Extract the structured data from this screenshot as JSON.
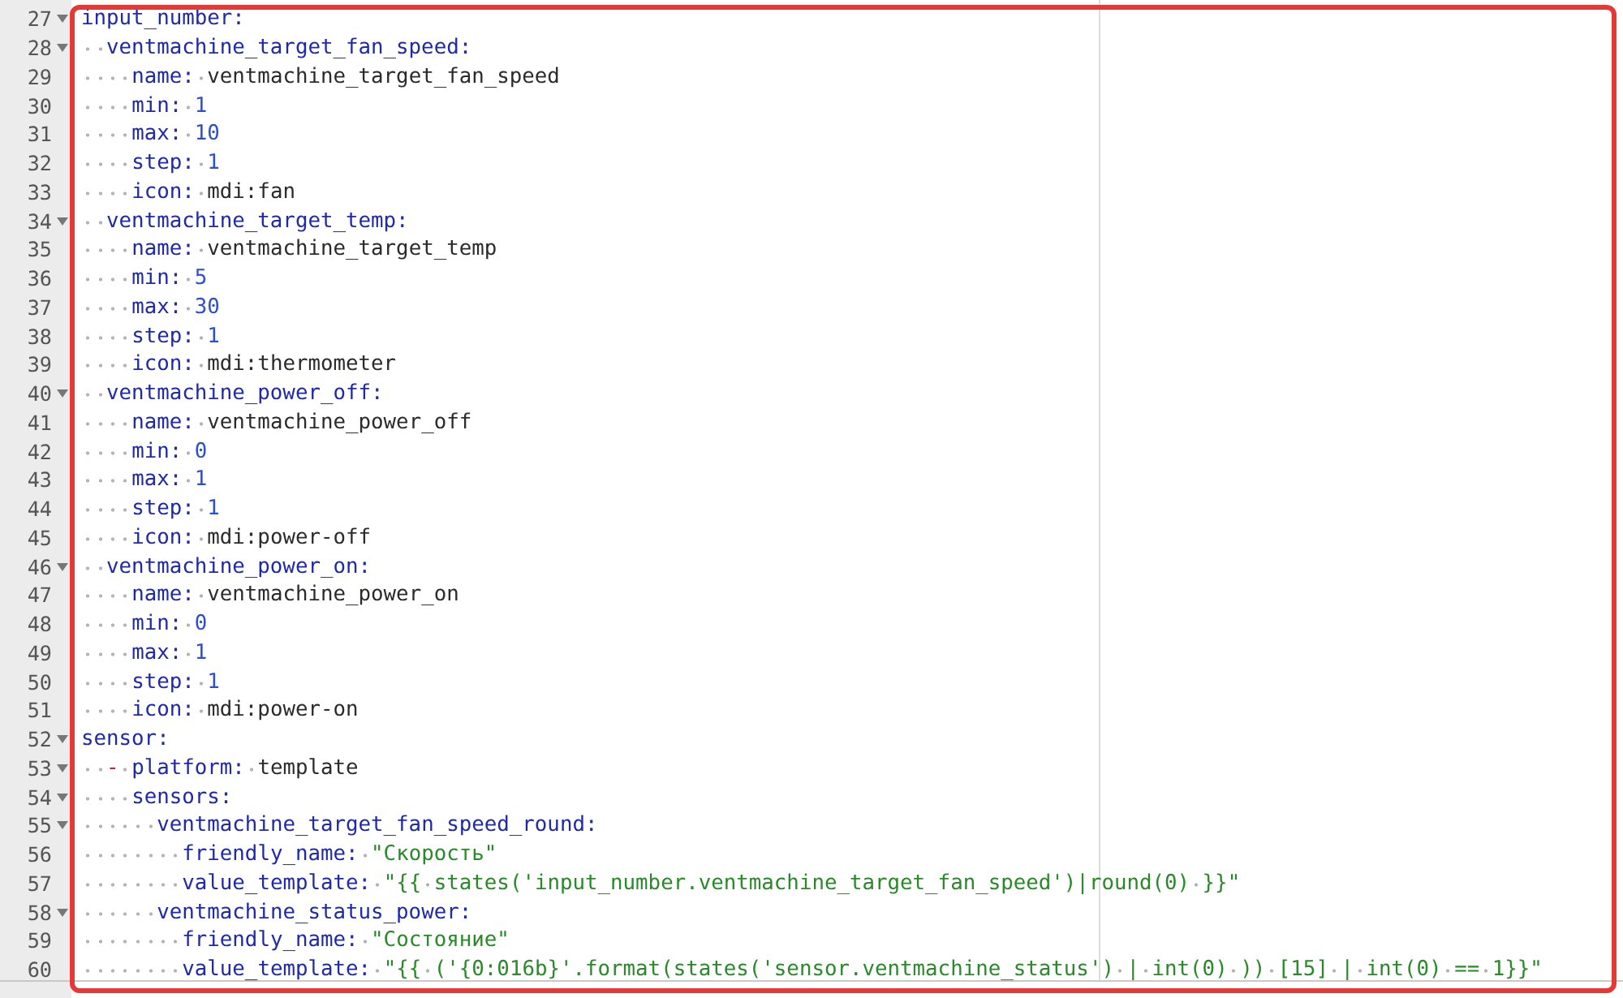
{
  "editor": {
    "lines": [
      {
        "number": "27",
        "fold": true,
        "tokens": [
          {
            "kind": "key",
            "text": "input_number:"
          }
        ]
      },
      {
        "number": "28",
        "fold": true,
        "tokens": [
          {
            "kind": "key",
            "text": "  ventmachine_target_fan_speed:"
          }
        ]
      },
      {
        "number": "29",
        "fold": false,
        "tokens": [
          {
            "kind": "key",
            "text": "    name:"
          },
          {
            "kind": "plain",
            "text": " ventmachine_target_fan_speed"
          }
        ]
      },
      {
        "number": "30",
        "fold": false,
        "tokens": [
          {
            "kind": "key",
            "text": "    min:"
          },
          {
            "kind": "num",
            "text": " 1"
          }
        ]
      },
      {
        "number": "31",
        "fold": false,
        "tokens": [
          {
            "kind": "key",
            "text": "    max:"
          },
          {
            "kind": "num",
            "text": " 10"
          }
        ]
      },
      {
        "number": "32",
        "fold": false,
        "tokens": [
          {
            "kind": "key",
            "text": "    step:"
          },
          {
            "kind": "num",
            "text": " 1"
          }
        ]
      },
      {
        "number": "33",
        "fold": false,
        "tokens": [
          {
            "kind": "key",
            "text": "    icon:"
          },
          {
            "kind": "plain",
            "text": " mdi:fan"
          }
        ]
      },
      {
        "number": "34",
        "fold": true,
        "tokens": [
          {
            "kind": "key",
            "text": "  ventmachine_target_temp:"
          }
        ]
      },
      {
        "number": "35",
        "fold": false,
        "tokens": [
          {
            "kind": "key",
            "text": "    name:"
          },
          {
            "kind": "plain",
            "text": " ventmachine_target_temp"
          }
        ]
      },
      {
        "number": "36",
        "fold": false,
        "tokens": [
          {
            "kind": "key",
            "text": "    min:"
          },
          {
            "kind": "num",
            "text": " 5"
          }
        ]
      },
      {
        "number": "37",
        "fold": false,
        "tokens": [
          {
            "kind": "key",
            "text": "    max:"
          },
          {
            "kind": "num",
            "text": " 30"
          }
        ]
      },
      {
        "number": "38",
        "fold": false,
        "tokens": [
          {
            "kind": "key",
            "text": "    step:"
          },
          {
            "kind": "num",
            "text": " 1"
          }
        ]
      },
      {
        "number": "39",
        "fold": false,
        "tokens": [
          {
            "kind": "key",
            "text": "    icon:"
          },
          {
            "kind": "plain",
            "text": " mdi:thermometer"
          }
        ]
      },
      {
        "number": "40",
        "fold": true,
        "tokens": [
          {
            "kind": "key",
            "text": "  ventmachine_power_off:"
          }
        ]
      },
      {
        "number": "41",
        "fold": false,
        "tokens": [
          {
            "kind": "key",
            "text": "    name:"
          },
          {
            "kind": "plain",
            "text": " ventmachine_power_off"
          }
        ]
      },
      {
        "number": "42",
        "fold": false,
        "tokens": [
          {
            "kind": "key",
            "text": "    min:"
          },
          {
            "kind": "num",
            "text": " 0"
          }
        ]
      },
      {
        "number": "43",
        "fold": false,
        "tokens": [
          {
            "kind": "key",
            "text": "    max:"
          },
          {
            "kind": "num",
            "text": " 1"
          }
        ]
      },
      {
        "number": "44",
        "fold": false,
        "tokens": [
          {
            "kind": "key",
            "text": "    step:"
          },
          {
            "kind": "num",
            "text": " 1"
          }
        ]
      },
      {
        "number": "45",
        "fold": false,
        "tokens": [
          {
            "kind": "key",
            "text": "    icon:"
          },
          {
            "kind": "plain",
            "text": " mdi:power-off"
          }
        ]
      },
      {
        "number": "46",
        "fold": true,
        "tokens": [
          {
            "kind": "key",
            "text": "  ventmachine_power_on:"
          }
        ]
      },
      {
        "number": "47",
        "fold": false,
        "tokens": [
          {
            "kind": "key",
            "text": "    name:"
          },
          {
            "kind": "plain",
            "text": " ventmachine_power_on"
          }
        ]
      },
      {
        "number": "48",
        "fold": false,
        "tokens": [
          {
            "kind": "key",
            "text": "    min:"
          },
          {
            "kind": "num",
            "text": " 0"
          }
        ]
      },
      {
        "number": "49",
        "fold": false,
        "tokens": [
          {
            "kind": "key",
            "text": "    max:"
          },
          {
            "kind": "num",
            "text": " 1"
          }
        ]
      },
      {
        "number": "50",
        "fold": false,
        "tokens": [
          {
            "kind": "key",
            "text": "    step:"
          },
          {
            "kind": "num",
            "text": " 1"
          }
        ]
      },
      {
        "number": "51",
        "fold": false,
        "tokens": [
          {
            "kind": "key",
            "text": "    icon:"
          },
          {
            "kind": "plain",
            "text": " mdi:power-on"
          }
        ]
      },
      {
        "number": "52",
        "fold": true,
        "tokens": [
          {
            "kind": "key",
            "text": "sensor:"
          }
        ]
      },
      {
        "number": "53",
        "fold": true,
        "tokens": [
          {
            "kind": "dash",
            "text": "  -"
          },
          {
            "kind": "key",
            "text": " platform:"
          },
          {
            "kind": "plain",
            "text": " template"
          }
        ]
      },
      {
        "number": "54",
        "fold": true,
        "tokens": [
          {
            "kind": "key",
            "text": "    sensors:"
          }
        ]
      },
      {
        "number": "55",
        "fold": true,
        "tokens": [
          {
            "kind": "key",
            "text": "      ventmachine_target_fan_speed_round:"
          }
        ]
      },
      {
        "number": "56",
        "fold": false,
        "tokens": [
          {
            "kind": "key",
            "text": "        friendly_name:"
          },
          {
            "kind": "str",
            "text": " \"Скорость\""
          }
        ]
      },
      {
        "number": "57",
        "fold": false,
        "tokens": [
          {
            "kind": "key",
            "text": "        value_template:"
          },
          {
            "kind": "str",
            "text": " \"{{ states('input_number.ventmachine_target_fan_speed')|round(0) }}\""
          }
        ]
      },
      {
        "number": "58",
        "fold": true,
        "tokens": [
          {
            "kind": "key",
            "text": "      ventmachine_status_power:"
          }
        ]
      },
      {
        "number": "59",
        "fold": false,
        "tokens": [
          {
            "kind": "key",
            "text": "        friendly_name:"
          },
          {
            "kind": "str",
            "text": " \"Состояние\""
          }
        ]
      },
      {
        "number": "60",
        "fold": false,
        "tokens": [
          {
            "kind": "key",
            "text": "        value_template:"
          },
          {
            "kind": "str",
            "text": " \"{{ ('{0:016b}'.format(states('sensor.ventmachine_status') | int(0) )) [15] | int(0) == 1}}\""
          }
        ]
      }
    ]
  }
}
